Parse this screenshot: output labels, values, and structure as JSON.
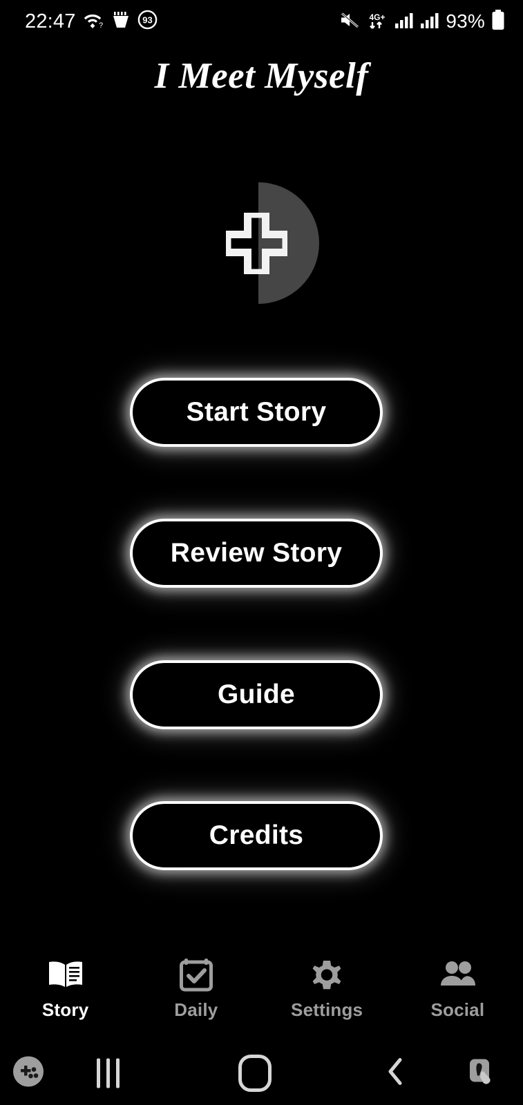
{
  "status_bar": {
    "time": "22:47",
    "battery_percent": "93%",
    "network_type": "4G+",
    "notification_badge": "93",
    "icons": [
      "wifi-question-icon",
      "app-notification-icon",
      "badge-count-icon",
      "mute-icon",
      "data-transfer-icon",
      "signal-bars-icon-1",
      "signal-bars-icon-2",
      "battery-icon"
    ]
  },
  "header": {
    "title": "I Meet Myself"
  },
  "logo": {
    "name": "half-circle-plus-logo",
    "half_circle_color": "#464646",
    "plus_color": "#ffffff"
  },
  "menu": {
    "buttons": [
      {
        "label": "Start Story",
        "name": "start-story-button"
      },
      {
        "label": "Review Story",
        "name": "review-story-button"
      },
      {
        "label": "Guide",
        "name": "guide-button"
      },
      {
        "label": "Credits",
        "name": "credits-button"
      }
    ],
    "glow_color": "#ffffff",
    "fill_color": "#000000"
  },
  "tab_bar": {
    "active_color": "#ffffff",
    "inactive_color": "#9e9e9e",
    "tabs": [
      {
        "label": "Story",
        "icon": "open-book-icon",
        "active": true
      },
      {
        "label": "Daily",
        "icon": "calendar-check-icon",
        "active": false
      },
      {
        "label": "Settings",
        "icon": "gear-icon",
        "active": false
      },
      {
        "label": "Social",
        "icon": "people-group-icon",
        "active": false
      }
    ]
  },
  "nav_bar": {
    "items": [
      {
        "name": "game-launcher-icon"
      },
      {
        "name": "recents-icon"
      },
      {
        "name": "home-icon"
      },
      {
        "name": "back-icon"
      },
      {
        "name": "screenshot-touch-icon"
      }
    ]
  }
}
